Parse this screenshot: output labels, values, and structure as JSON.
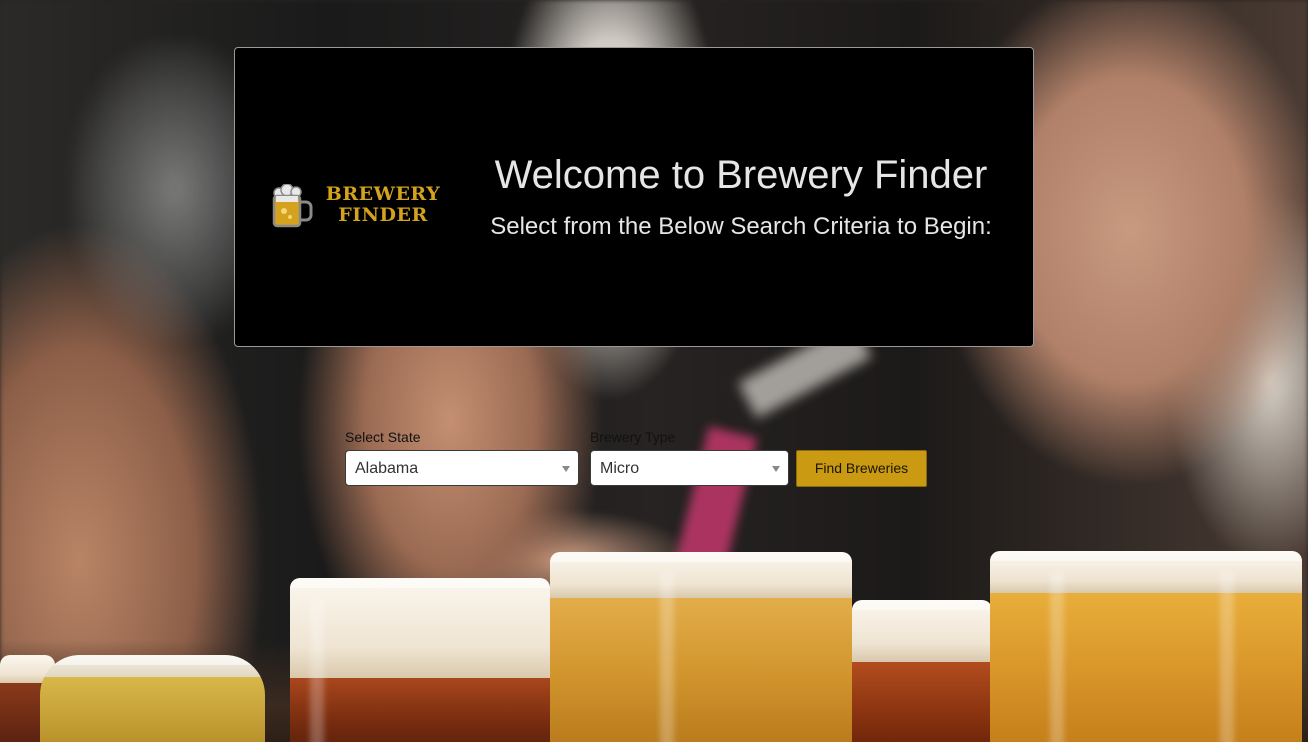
{
  "header": {
    "logo": {
      "line1": "BREWERY",
      "line2": "FINDER",
      "icon": "beer-mug-icon",
      "color": "#d4a21c"
    },
    "title": "Welcome to Brewery Finder",
    "subtitle": "Select from the Below Search Criteria to Begin:"
  },
  "search": {
    "state": {
      "label": "Select State",
      "selected": "Alabama"
    },
    "type": {
      "label": "Brewery Type",
      "selected": "Micro"
    },
    "button_label": "Find Breweries",
    "button_color": "#c99a12"
  },
  "background": {
    "description_icon": "beer-glasses-photo"
  }
}
